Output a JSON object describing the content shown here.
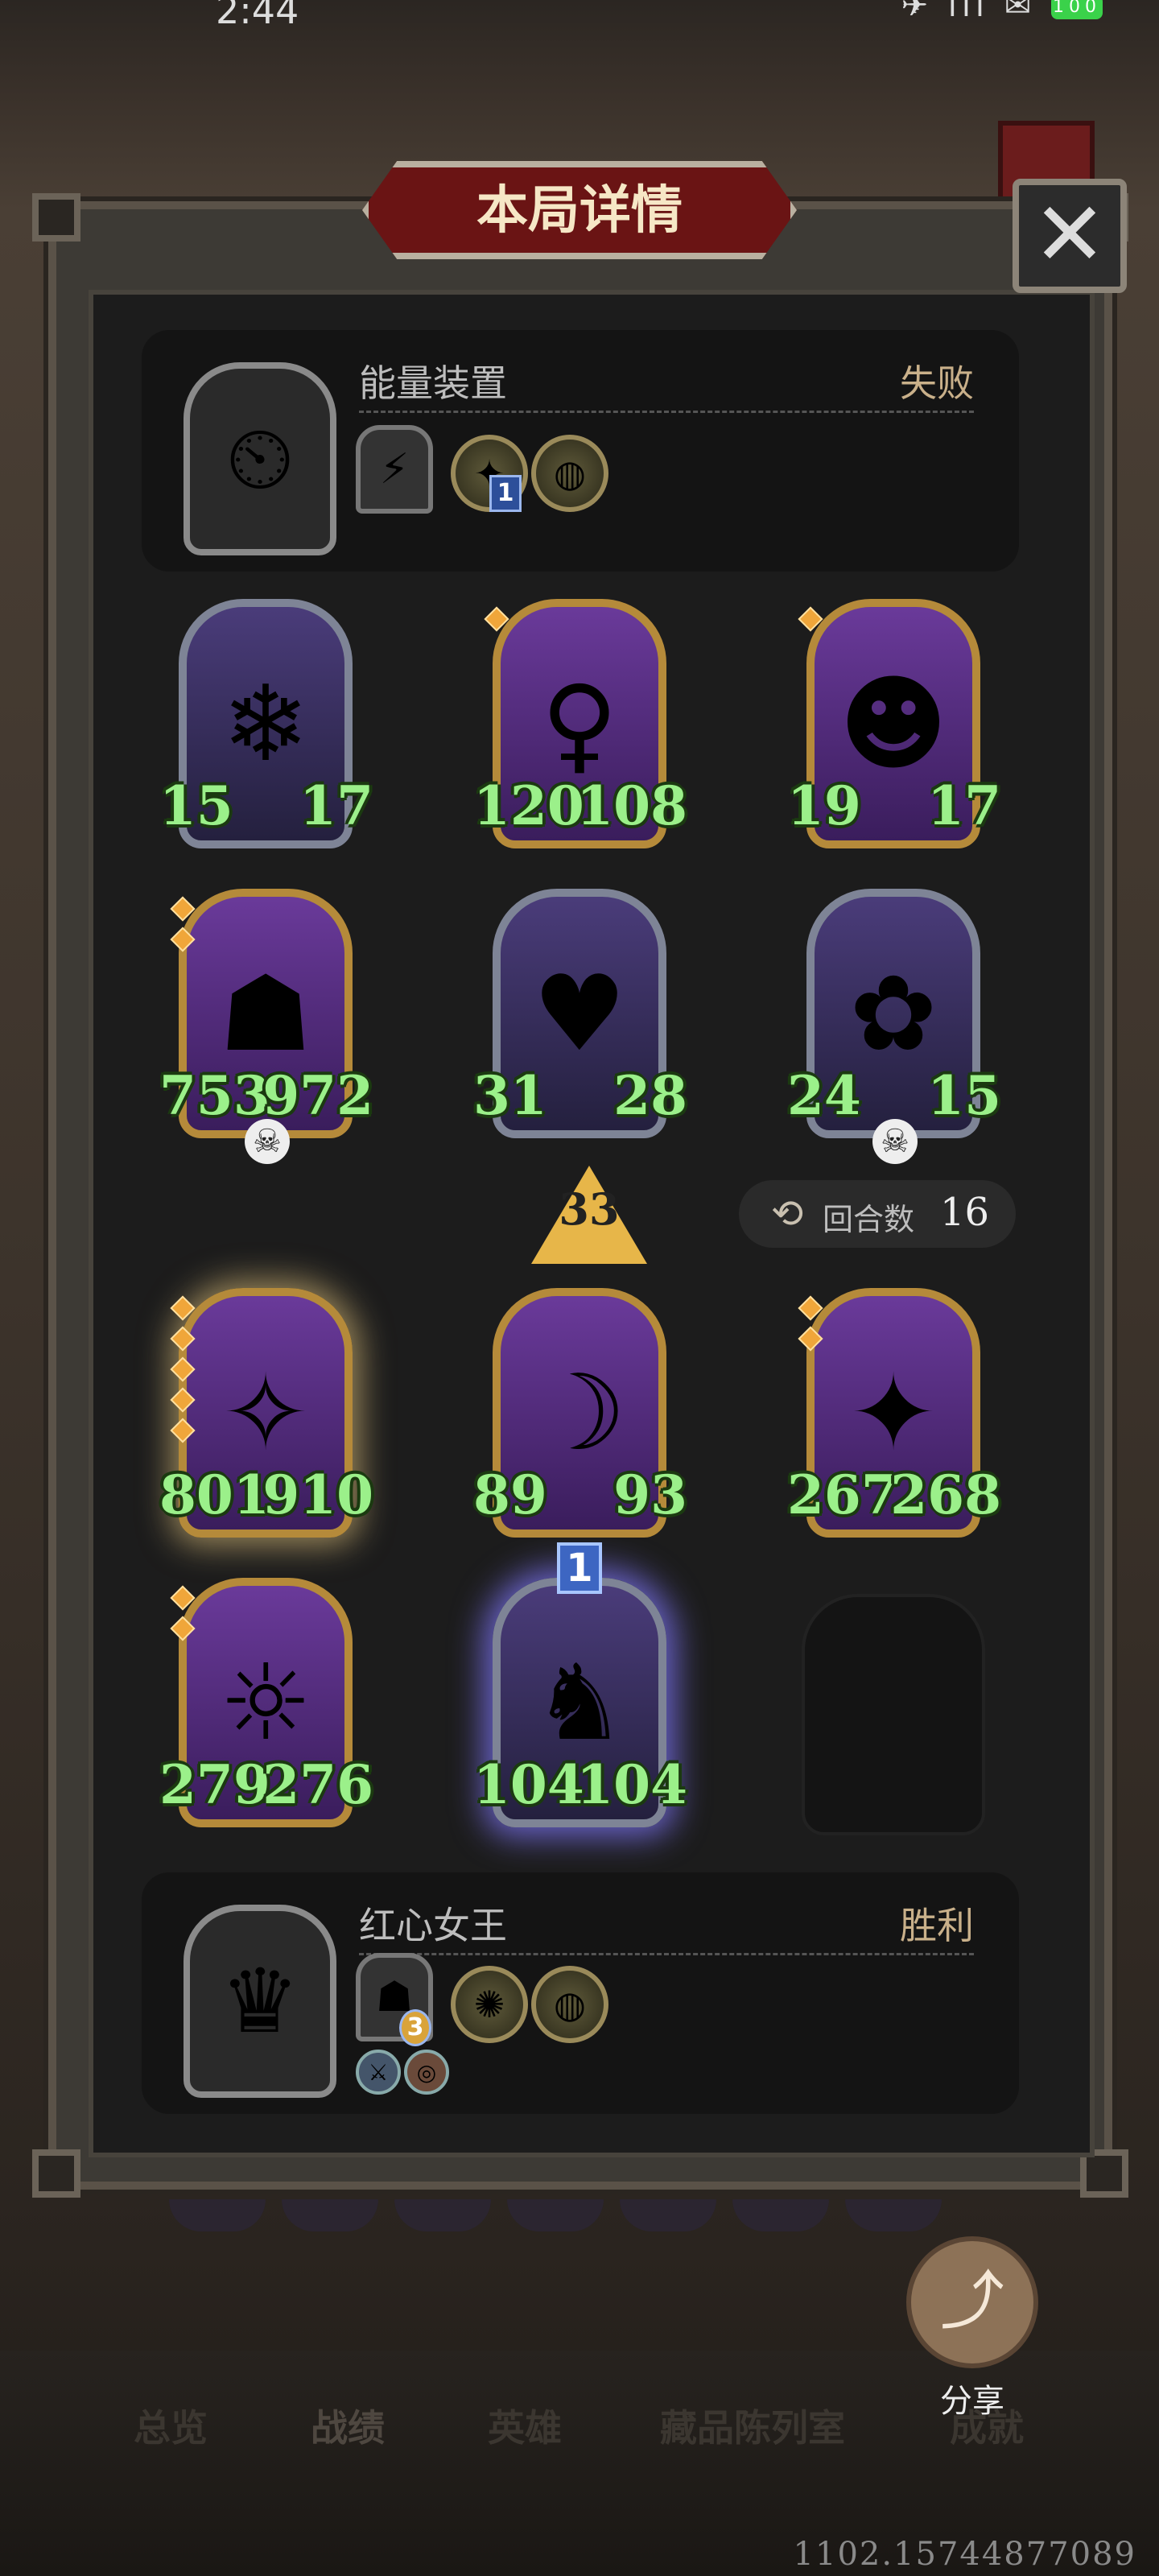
{
  "status_bar": {
    "time": "2:44",
    "signal": "✈ ıll ✉",
    "battery": "100"
  },
  "dialog": {
    "title": "本局详情",
    "close_label": "✕"
  },
  "opponent": {
    "name": "能量装置",
    "result": "失败",
    "portrait_icon": "⏲",
    "tile_icon": "⚡",
    "orb1_icon": "✦",
    "orb1_badge": "1",
    "orb2_icon": "◍"
  },
  "player": {
    "name": "红心女王",
    "result": "胜利",
    "portrait_icon": "♛",
    "tile_icon": "☗",
    "tile_badge": "3",
    "orb1_icon": "✺",
    "orb2_icon": "◍",
    "small1_icon": "⚔",
    "small2_icon": "◎"
  },
  "tier": "33",
  "rounds": {
    "label": "回合数",
    "value": "16"
  },
  "enemy_board": [
    {
      "atk": "15",
      "hp": "17",
      "icon": "❄"
    },
    {
      "atk": "120",
      "hp": "108",
      "icon": "♀"
    },
    {
      "atk": "19",
      "hp": "17",
      "icon": "☻"
    },
    {
      "atk": "753",
      "hp": "972",
      "icon": "☗"
    },
    {
      "atk": "31",
      "hp": "28",
      "icon": "♥"
    },
    {
      "atk": "24",
      "hp": "15",
      "icon": "✿"
    }
  ],
  "my_board": [
    {
      "atk": "801",
      "hp": "910",
      "icon": "✧"
    },
    {
      "atk": "89",
      "hp": "93",
      "icon": "☽"
    },
    {
      "atk": "267",
      "hp": "268",
      "icon": "✦"
    },
    {
      "atk": "279",
      "hp": "276",
      "icon": "☼"
    },
    {
      "atk": "104",
      "hp": "104",
      "icon": "♞",
      "level": "1"
    }
  ],
  "skull_icon": "☠",
  "share": {
    "label": "分享",
    "icon": "⤴"
  },
  "nav": {
    "items": [
      "总览",
      "战绩",
      "英雄",
      "藏品陈列室",
      "成就"
    ]
  },
  "footer_id": "1102.15744877089"
}
